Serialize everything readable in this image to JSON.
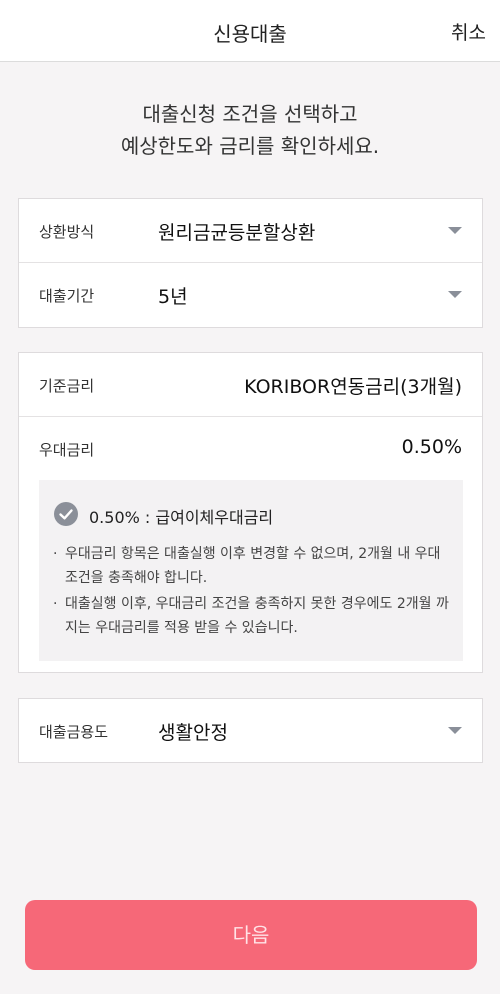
{
  "header": {
    "title": "신용대출",
    "cancel_label": "취소"
  },
  "intro": {
    "line1": "대출신청 조건을 선택하고",
    "line2": "예상한도와 금리를 확인하세요."
  },
  "repayment": {
    "label": "상환방식",
    "value": "원리금균등분할상환"
  },
  "term": {
    "label": "대출기간",
    "value": "5년"
  },
  "base_rate": {
    "label": "기준금리",
    "value": "KORIBOR연동금리(3개월)"
  },
  "preferential_rate": {
    "label": "우대금리",
    "value": "0.50%"
  },
  "benefit": {
    "text": "0.50% : 급여이체우대금리"
  },
  "notes": [
    "우대금리 항목은 대출실행 이후 변경할 수 없으며, 2개월 내 우대조건을 충족해야 합니다.",
    "대출실행 이후, 우대금리 조건을 충족하지 못한 경우에도 2개월 까지는 우대금리를 적용 받을 수 있습니다."
  ],
  "purpose": {
    "label": "대출금용도",
    "value": "생활안정"
  },
  "next_button": {
    "label": "다음"
  },
  "colors": {
    "accent": "#f66878",
    "background": "#f6f4f5",
    "icon": "#8b9099"
  }
}
